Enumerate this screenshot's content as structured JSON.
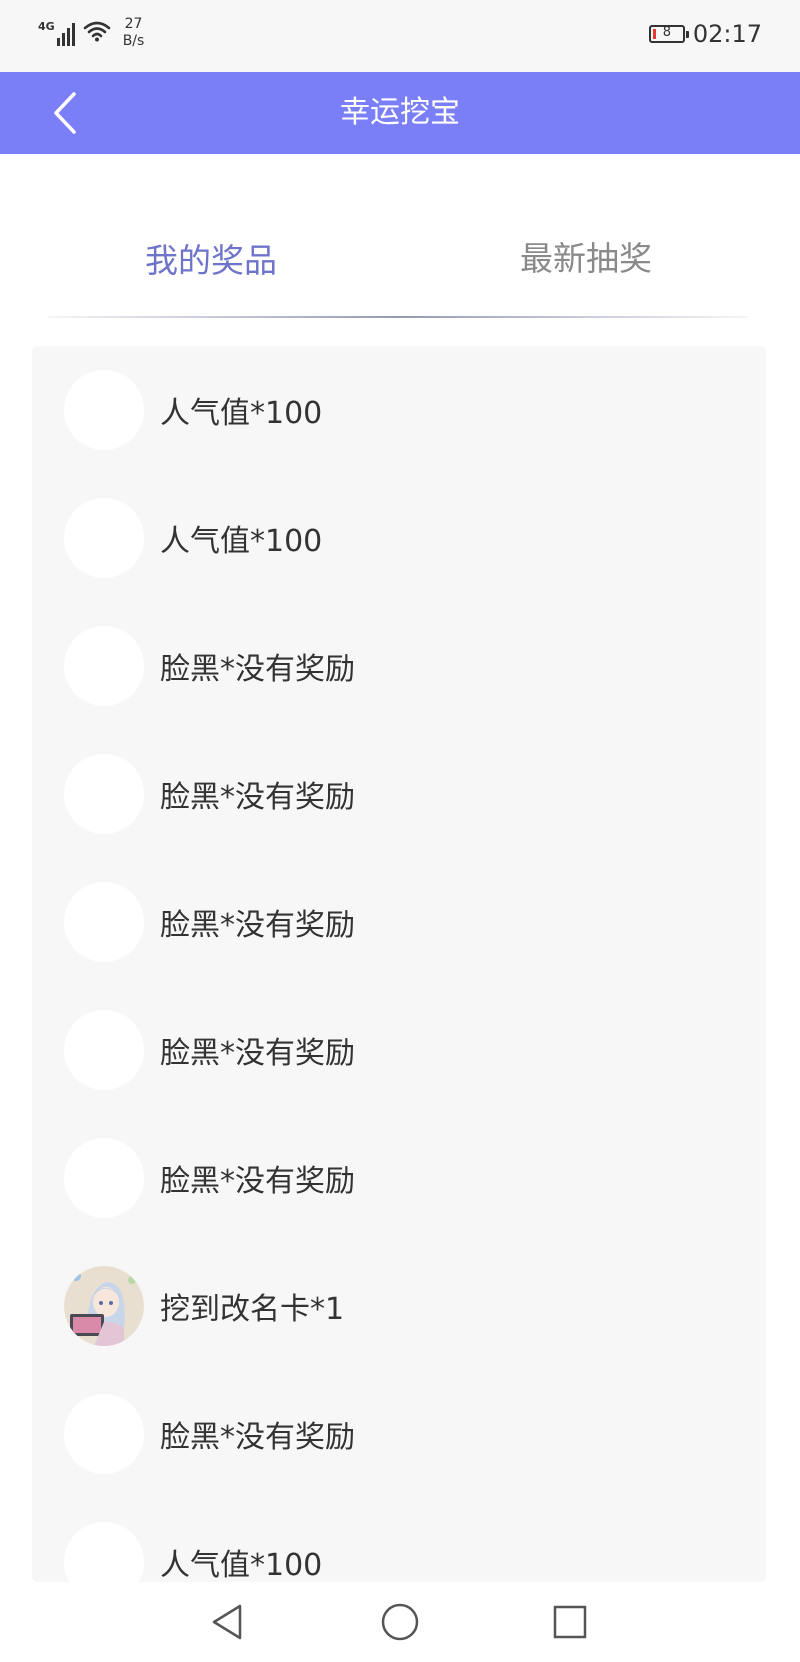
{
  "status_bar": {
    "network": "4G",
    "speed_value": "27",
    "speed_unit": "B/s",
    "battery_level": "8",
    "time": "02:17"
  },
  "app_bar": {
    "title": "幸运挖宝",
    "back_icon": "chevron-left-icon"
  },
  "tabs": [
    {
      "label": "我的奖品",
      "active": true
    },
    {
      "label": "最新抽奖",
      "active": false
    }
  ],
  "colors": {
    "accent": "#7b7ff7",
    "active_tab": "#6e74c9",
    "inactive_tab": "#8a8a8a",
    "list_bg": "#f7f7f7"
  },
  "prizes": [
    {
      "label": "人气值*100",
      "avatar": "blank"
    },
    {
      "label": "人气值*100",
      "avatar": "blank"
    },
    {
      "label": "脸黑*没有奖励",
      "avatar": "blank"
    },
    {
      "label": "脸黑*没有奖励",
      "avatar": "blank"
    },
    {
      "label": "脸黑*没有奖励",
      "avatar": "blank"
    },
    {
      "label": "脸黑*没有奖励",
      "avatar": "blank"
    },
    {
      "label": "脸黑*没有奖励",
      "avatar": "blank"
    },
    {
      "label": "挖到改名卡*1",
      "avatar": "anime-girl-illustration"
    },
    {
      "label": "脸黑*没有奖励",
      "avatar": "blank"
    },
    {
      "label": "人气值*100",
      "avatar": "blank"
    }
  ],
  "nav_bar": {
    "back": "triangle-back-icon",
    "home": "circle-home-icon",
    "recents": "square-recents-icon"
  }
}
